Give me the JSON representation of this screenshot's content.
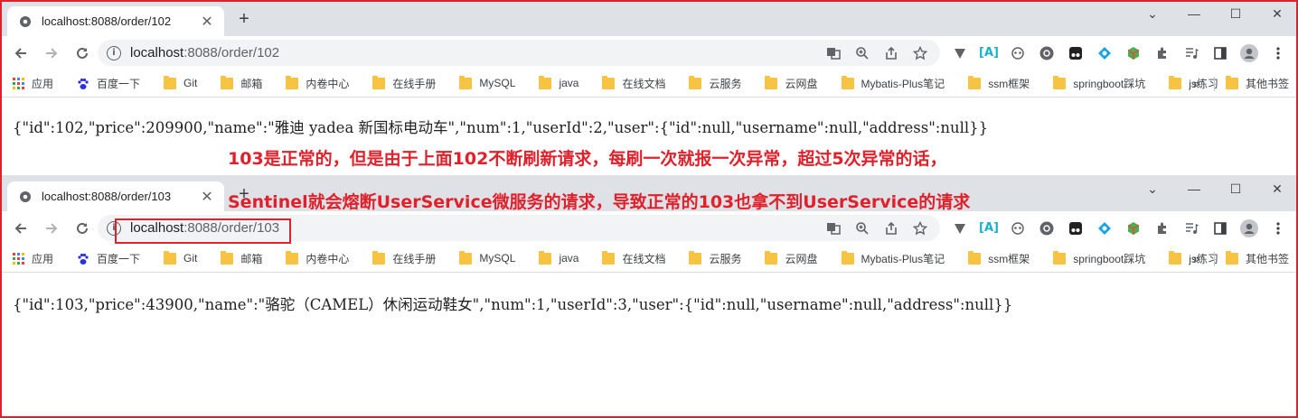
{
  "colors": {
    "annotation": "#e0202a",
    "tabstrip": "#dee1e6",
    "omnibox": "#f1f3f4",
    "folder": "#f6c343"
  },
  "browsers": [
    {
      "tab_title": "localhost:8088/order/102",
      "url_host": "localhost",
      "url_rest": ":8088/order/102",
      "body_text": "{\"id\":102,\"price\":209900,\"name\":\"雅迪 yadea 新国标电动车\",\"num\":1,\"userId\":2,\"user\":{\"id\":null,\"username\":null,\"address\":null}}"
    },
    {
      "tab_title": "localhost:8088/order/103",
      "url_host": "localhost",
      "url_rest": ":8088/order/103",
      "body_text": "{\"id\":103,\"price\":43900,\"name\":\"骆驼（CAMEL）休闲运动鞋女\",\"num\":1,\"userId\":3,\"user\":{\"id\":null,\"username\":null,\"address\":null}}"
    }
  ],
  "bookmarks": {
    "apps": "应用",
    "items": [
      "百度一下",
      "Git",
      "邮箱",
      "内卷中心",
      "在线手册",
      "MySQL",
      "java",
      "在线文档",
      "云服务",
      "云网盘",
      "Mybatis-Plus笔记",
      "ssm框架",
      "springboot踩坑",
      "js练习"
    ],
    "overflow": "»",
    "other": "其他书签"
  },
  "icons": {
    "back": "arrow-left-icon",
    "forward": "arrow-right-icon",
    "reload": "reload-icon",
    "info": "info-icon",
    "translate": "translate-icon",
    "zoom": "zoom-icon",
    "share": "share-icon",
    "bookmark": "star-icon",
    "extensions": "puzzle-icon",
    "menu": "kebab-menu-icon"
  },
  "annotations": {
    "line1": "103是正常的，但是由于上面102不断刷新请求，每刷一次就报一次异常，超过5次异常的话，",
    "line2": "Sentinel就会熔断UserService微服务的请求，导致正常的103也拿不到UserService的请求"
  }
}
